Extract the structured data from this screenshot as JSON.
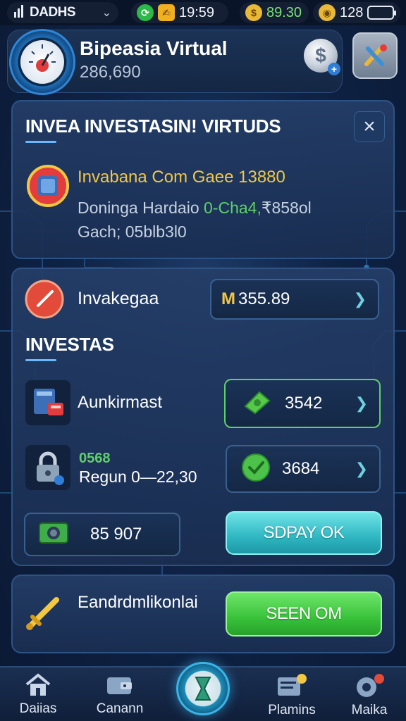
{
  "status_bar": {
    "carrier": "DADHS",
    "time": "19:59",
    "coins": "89.30",
    "count": "128"
  },
  "header": {
    "title": "Bipeasia Virtual",
    "balance": "286,690"
  },
  "invest_panel": {
    "title": "INVEA INVESTASIN! VIRTUDS",
    "headline": "Invabana Com Gaee 13880",
    "line1": "Doninga Hardaio",
    "line1_highlight": "0-Cha4,",
    "line1_tail": "₹858ol",
    "line2": "Gach; 05blb3l0"
  },
  "main_panel": {
    "top_label": "Invakegaa",
    "top_value_prefix": "M",
    "top_value": "355.89",
    "section_title": "INVESTAS",
    "rows": [
      {
        "label": "Aunkirmast",
        "value": "3542"
      },
      {
        "label_top": "0568",
        "label": "Regun 0—22,30",
        "value": "3684"
      }
    ],
    "bottom_value": "85 907",
    "action_button": "SDPAY OK"
  },
  "bottom_panel": {
    "label": "Eandrdmlikonlai",
    "action_button": "SEEN OM"
  },
  "nav": {
    "items": [
      "Daiias",
      "Canann",
      "Plamins",
      "Maika"
    ]
  },
  "colors": {
    "accent_teal": "#2fb7c2",
    "accent_green": "#39c23a",
    "headline_gold": "#f2c744",
    "highlight_green": "#5ed06a"
  }
}
